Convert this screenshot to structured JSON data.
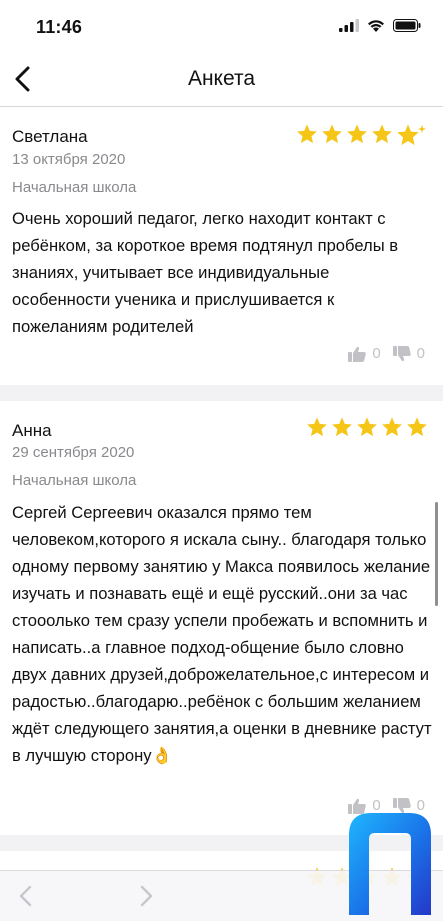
{
  "status_bar": {
    "time": "11:46"
  },
  "nav": {
    "title": "Анкета"
  },
  "reviews": [
    {
      "author": "Светлана",
      "date": "13 октября 2020",
      "category": "Начальная школа",
      "rating": 5,
      "text": "Очень хороший педагог, легко находит контакт с ребёнком, за короткое время подтянул пробелы в знаниях, учитывает все индивидуальные особенности ученика и прислушивается к пожеланиям родителей",
      "likes": "0",
      "dislikes": "0"
    },
    {
      "author": "Анна",
      "date": "29 сентября 2020",
      "category": "Начальная школа",
      "rating": 5,
      "text": "Сергей Сергеевич оказался прямо тем человеком,которого я искала сыну.. благодаря только одному первому занятию у Макса появилось желание изучать и познавать ещё и ещё русский..они за час стооолько тем сразу успели пробежать и вспомнить и написать..а главное подход-общение было словно двух давних друзей,доброжелательное,с интересом и радостью..благодарю..ребёнок с большим желанием ждёт следующего занятия,а оценки в дневнике растут в лучшую сторону👌",
      "likes": "0",
      "dislikes": "0"
    }
  ],
  "colors": {
    "star": "#f5c518",
    "accent": "#1a73e8",
    "muted": "#8a8a8e"
  }
}
